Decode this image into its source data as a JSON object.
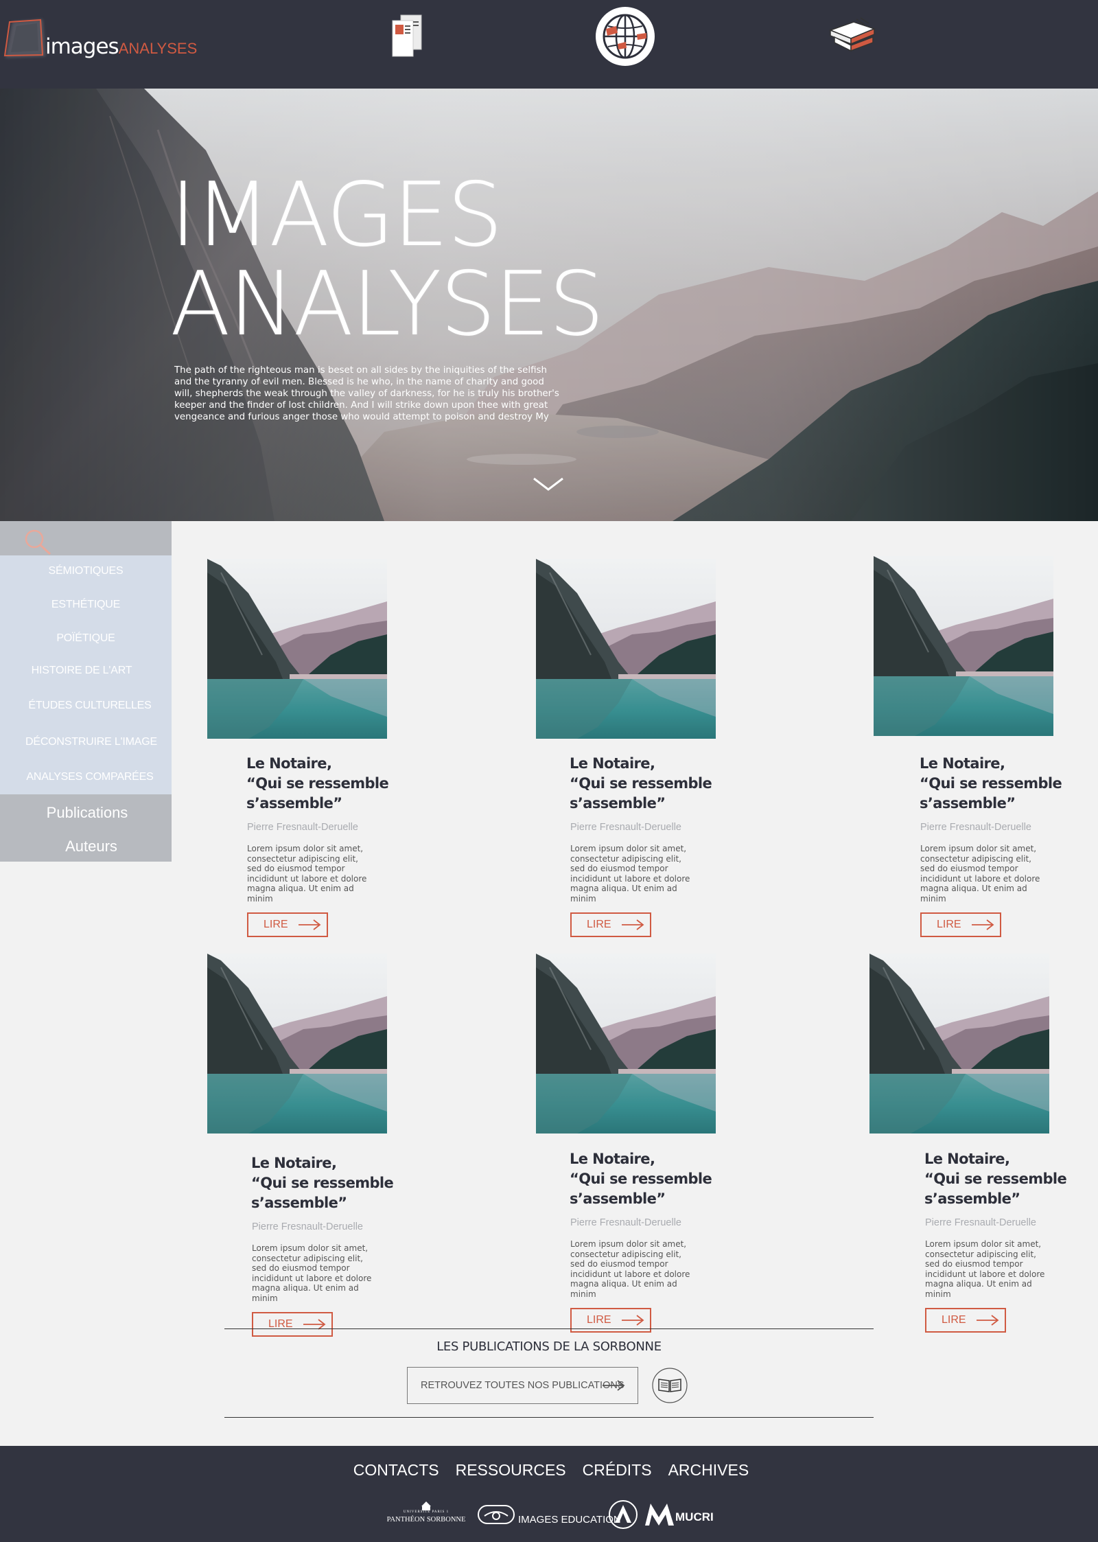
{
  "header": {
    "logo_main": "images",
    "logo_accent": "ANALYSES",
    "icons": [
      "documents-icon",
      "globe-icon",
      "books-icon"
    ]
  },
  "hero": {
    "title_line1": "IMAGES",
    "title_line2": "ANALYSES",
    "text": "The path of the righteous man is beset on all sides by the iniquities of the selfish and the tyranny of evil men. Blessed is he who, in the name of charity and good will, shepherds the weak through the valley of darkness, for he is truly his brother's keeper and the finder of lost children. And I will strike down upon thee with great vengeance and furious anger those who would attempt to poison and destroy My"
  },
  "sidebar": {
    "categories": [
      {
        "label": "SÉMIOTIQUES"
      },
      {
        "label": "ESTHÉTIQUE"
      },
      {
        "label": "POÏÉTIQUE"
      },
      {
        "label": "HISTOIRE DE L'ART"
      },
      {
        "label": "ÉTUDES CULTURELLES"
      },
      {
        "label": "DÉCONSTRUIRE L'IMAGE"
      },
      {
        "label": "ANALYSES COMPARÉES"
      }
    ],
    "nav": [
      {
        "label": "Publications"
      },
      {
        "label": "Auteurs"
      }
    ]
  },
  "cards": [
    {
      "title_l1": "Le Notaire,",
      "title_l2": "“Qui se ressemble",
      "title_l3": "s’assemble”",
      "author": "Pierre Fresnault-Deruelle",
      "desc": "Lorem ipsum dolor sit amet, consectetur adipiscing elit, sed do eiusmod tempor incididunt ut labore et dolore magna aliqua. Ut enim ad minim",
      "button": "LIRE"
    },
    {
      "title_l1": "Le Notaire,",
      "title_l2": "“Qui se ressemble",
      "title_l3": "s’assemble”",
      "author": "Pierre Fresnault-Deruelle",
      "desc": "Lorem ipsum dolor sit amet, consectetur adipiscing elit, sed do eiusmod tempor incididunt ut labore et dolore magna aliqua. Ut enim ad minim",
      "button": "LIRE"
    },
    {
      "title_l1": "Le Notaire,",
      "title_l2": "“Qui se ressemble",
      "title_l3": "s’assemble”",
      "author": "Pierre Fresnault-Deruelle",
      "desc": "Lorem ipsum dolor sit amet, consectetur adipiscing elit, sed do eiusmod tempor incididunt ut labore et dolore magna aliqua. Ut enim ad minim",
      "button": "LIRE"
    },
    {
      "title_l1": "Le Notaire,",
      "title_l2": "“Qui se ressemble",
      "title_l3": "s’assemble”",
      "author": "Pierre Fresnault-Deruelle",
      "desc": "Lorem ipsum dolor sit amet, consectetur adipiscing elit, sed do eiusmod tempor incididunt ut labore et dolore magna aliqua. Ut enim ad minim",
      "button": "LIRE"
    },
    {
      "title_l1": "Le Notaire,",
      "title_l2": "“Qui se ressemble",
      "title_l3": "s’assemble”",
      "author": "Pierre Fresnault-Deruelle",
      "desc": "Lorem ipsum dolor sit amet, consectetur adipiscing elit, sed do eiusmod tempor incididunt ut labore et dolore magna aliqua. Ut enim ad minim",
      "button": "LIRE"
    },
    {
      "title_l1": "Le Notaire,",
      "title_l2": "“Qui se ressemble",
      "title_l3": "s’assemble”",
      "author": "Pierre Fresnault-Deruelle",
      "desc": "Lorem ipsum dolor sit amet, consectetur adipiscing elit, sed do eiusmod tempor incididunt ut labore et dolore magna aliqua. Ut enim ad minim",
      "button": "LIRE"
    }
  ],
  "sorbonne": {
    "title": "LES PUBLICATIONS DE LA SORBONNE",
    "button": "RETROUVEZ TOUTES NOS PUBLICATIONS"
  },
  "footer": {
    "links": [
      "CONTACTS",
      "RESSOURCES",
      "CRÉDITS",
      "ARCHIVES"
    ],
    "partner_pantheon_small": "UNIVERSITÉ PARIS 1",
    "partner_pantheon": "PANTHÉON SORBONNE",
    "partner_images_education": "IMAGES EDUCATION",
    "partner_mucri": "MUCRI"
  },
  "colors": {
    "dark": "#323440",
    "accent": "#d05a42",
    "sidebar_light": "#d4dce8",
    "sidebar_gray": "#b7babf",
    "background": "#f2f2f2"
  }
}
